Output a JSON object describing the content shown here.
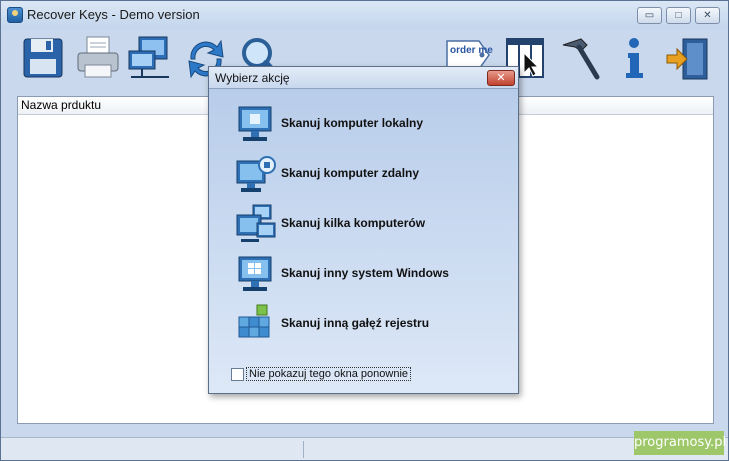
{
  "window": {
    "title": "Recover Keys - Demo version",
    "controls": {
      "minimize": "▭",
      "maximize": "□",
      "close": "✕"
    }
  },
  "toolbar": {
    "items": [
      {
        "name": "save-button",
        "icon": "floppy-disk-icon"
      },
      {
        "name": "print-button",
        "icon": "printer-icon"
      },
      {
        "name": "network-button",
        "icon": "network-computer-icon"
      },
      {
        "name": "refresh-button",
        "icon": "refresh-arrows-icon"
      },
      {
        "name": "search-button",
        "icon": "magnifier-icon"
      },
      {
        "name": "order-button",
        "icon": "order-me-tag-icon"
      },
      {
        "name": "select-columns-button",
        "icon": "columns-cursor-icon"
      },
      {
        "name": "tools-button",
        "icon": "hammer-icon"
      },
      {
        "name": "info-button",
        "icon": "info-icon"
      },
      {
        "name": "exit-button",
        "icon": "exit-door-icon"
      }
    ],
    "order_tag_text": "order me"
  },
  "list": {
    "columns": [
      "Nazwa prduktu"
    ]
  },
  "dialog": {
    "title": "Wybierz akcję",
    "close": "✕",
    "actions": [
      {
        "label": "Skanuj komputer lokalny",
        "icon": "local-computer-icon"
      },
      {
        "label": "Skanuj komputer zdalny",
        "icon": "remote-computer-icon"
      },
      {
        "label": "Skanuj kilka komputerów",
        "icon": "multiple-computers-icon"
      },
      {
        "label": "Skanuj inny system Windows",
        "icon": "windows-system-icon"
      },
      {
        "label": "Skanuj inną gałęź rejestru",
        "icon": "registry-cubes-icon"
      }
    ],
    "dont_show_again": "Nie pokazuj tego okna ponownie",
    "dont_show_checked": false
  },
  "watermark": "programosy.pl",
  "colors": {
    "accent": "#1f6fc0",
    "dialog_bg": "#c6d7ef",
    "close_red": "#c0422e"
  }
}
